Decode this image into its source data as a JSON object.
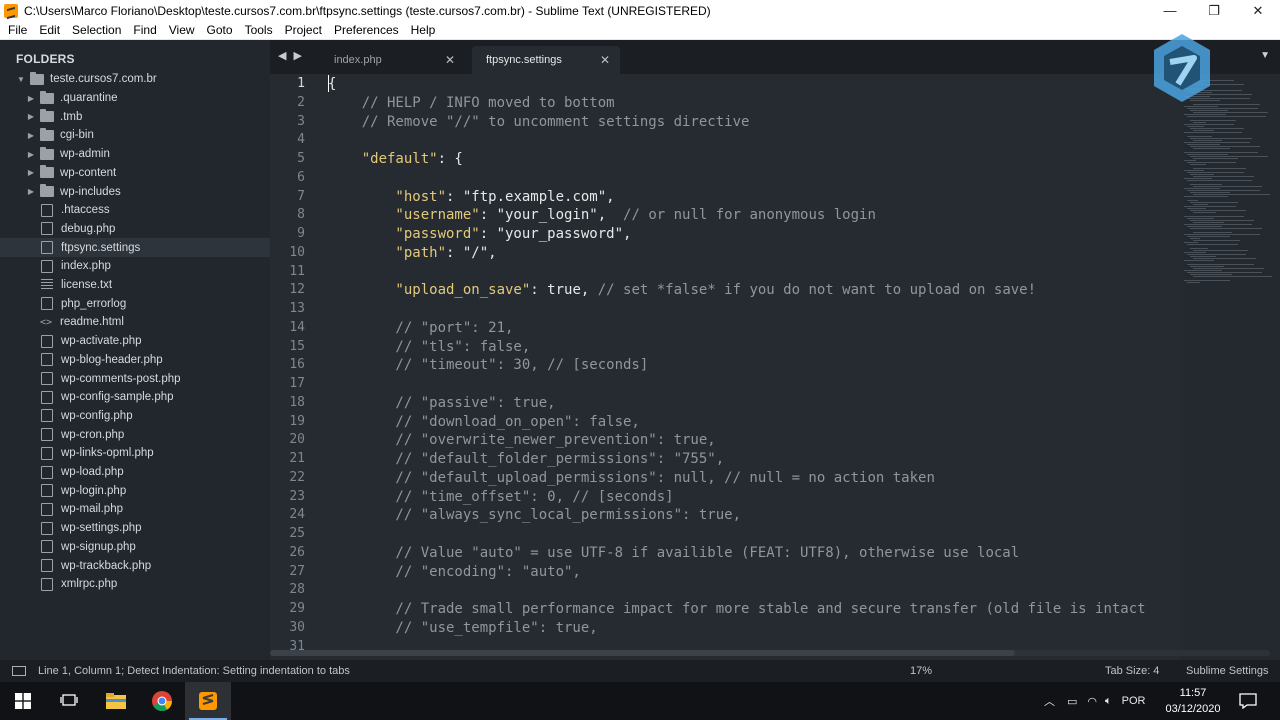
{
  "window": {
    "title": "C:\\Users\\Marco Floriano\\Desktop\\teste.cursos7.com.br\\ftpsync.settings (teste.cursos7.com.br) - Sublime Text (UNREGISTERED)",
    "minimize": "—",
    "maximize": "❐",
    "close": "✕"
  },
  "menu": [
    "File",
    "Edit",
    "Selection",
    "Find",
    "View",
    "Goto",
    "Tools",
    "Project",
    "Preferences",
    "Help"
  ],
  "sidebar": {
    "header": "FOLDERS",
    "root": "teste.cursos7.com.br",
    "folders": [
      ".quarantine",
      ".tmb",
      "cgi-bin",
      "wp-admin",
      "wp-content",
      "wp-includes"
    ],
    "files": [
      {
        "name": ".htaccess",
        "icon": "file-icon"
      },
      {
        "name": "debug.php",
        "icon": "file-icon"
      },
      {
        "name": "ftpsync.settings",
        "icon": "file-icon",
        "selected": true
      },
      {
        "name": "index.php",
        "icon": "file-icon"
      },
      {
        "name": "license.txt",
        "icon": "text-lines-icon"
      },
      {
        "name": "php_errorlog",
        "icon": "file-icon"
      },
      {
        "name": "readme.html",
        "icon": "code-icon"
      },
      {
        "name": "wp-activate.php",
        "icon": "file-icon"
      },
      {
        "name": "wp-blog-header.php",
        "icon": "file-icon"
      },
      {
        "name": "wp-comments-post.php",
        "icon": "file-icon"
      },
      {
        "name": "wp-config-sample.php",
        "icon": "file-icon"
      },
      {
        "name": "wp-config.php",
        "icon": "file-icon"
      },
      {
        "name": "wp-cron.php",
        "icon": "file-icon"
      },
      {
        "name": "wp-links-opml.php",
        "icon": "file-icon"
      },
      {
        "name": "wp-load.php",
        "icon": "file-icon"
      },
      {
        "name": "wp-login.php",
        "icon": "file-icon"
      },
      {
        "name": "wp-mail.php",
        "icon": "file-icon"
      },
      {
        "name": "wp-settings.php",
        "icon": "file-icon"
      },
      {
        "name": "wp-signup.php",
        "icon": "file-icon"
      },
      {
        "name": "wp-trackback.php",
        "icon": "file-icon"
      },
      {
        "name": "xmlrpc.php",
        "icon": "file-icon"
      }
    ]
  },
  "tabs": [
    {
      "label": "index.php",
      "active": false
    },
    {
      "label": "ftpsync.settings",
      "active": true
    }
  ],
  "tab_nav": "◀ ▶",
  "tab_menu": "▼",
  "editor": {
    "lines": [
      {
        "n": "1",
        "segs": [
          [
            "c-val",
            "{"
          ]
        ]
      },
      {
        "n": "2",
        "segs": [
          [
            "c-cmt",
            "    // HELP / INFO moved to bottom"
          ]
        ]
      },
      {
        "n": "3",
        "segs": [
          [
            "c-cmt",
            "    // Remove \"//\" to uncomment settings directive"
          ]
        ]
      },
      {
        "n": "4",
        "segs": []
      },
      {
        "n": "5",
        "segs": [
          [
            "c-key",
            "    \"default\""
          ],
          [
            "c-val",
            ": {"
          ]
        ]
      },
      {
        "n": "6",
        "segs": []
      },
      {
        "n": "7",
        "segs": [
          [
            "c-key",
            "        \"host\""
          ],
          [
            "c-val",
            ": "
          ],
          [
            "c-str",
            "\"ftp.example.com\""
          ],
          [
            "c-val",
            ","
          ]
        ]
      },
      {
        "n": "8",
        "segs": [
          [
            "c-key",
            "        \"username\""
          ],
          [
            "c-val",
            ": "
          ],
          [
            "c-str",
            "\"your_login\""
          ],
          [
            "c-val",
            ",  "
          ],
          [
            "c-cmt",
            "// or null for anonymous login"
          ]
        ]
      },
      {
        "n": "9",
        "segs": [
          [
            "c-key",
            "        \"password\""
          ],
          [
            "c-val",
            ": "
          ],
          [
            "c-str",
            "\"your_password\""
          ],
          [
            "c-val",
            ","
          ]
        ]
      },
      {
        "n": "10",
        "segs": [
          [
            "c-key",
            "        \"path\""
          ],
          [
            "c-val",
            ": "
          ],
          [
            "c-str",
            "\"/\""
          ],
          [
            "c-val",
            ","
          ]
        ]
      },
      {
        "n": "11",
        "segs": []
      },
      {
        "n": "12",
        "segs": [
          [
            "c-key",
            "        \"upload_on_save\""
          ],
          [
            "c-val",
            ": true, "
          ],
          [
            "c-cmt",
            "// set *false* if you do not want to upload on save!"
          ]
        ]
      },
      {
        "n": "13",
        "segs": []
      },
      {
        "n": "14",
        "segs": [
          [
            "c-cmt",
            "        // \"port\": 21,"
          ]
        ]
      },
      {
        "n": "15",
        "segs": [
          [
            "c-cmt",
            "        // \"tls\": false,"
          ]
        ]
      },
      {
        "n": "16",
        "segs": [
          [
            "c-cmt",
            "        // \"timeout\": 30, // [seconds]"
          ]
        ]
      },
      {
        "n": "17",
        "segs": []
      },
      {
        "n": "18",
        "segs": [
          [
            "c-cmt",
            "        // \"passive\": true,"
          ]
        ]
      },
      {
        "n": "19",
        "segs": [
          [
            "c-cmt",
            "        // \"download_on_open\": false,"
          ]
        ]
      },
      {
        "n": "20",
        "segs": [
          [
            "c-cmt",
            "        // \"overwrite_newer_prevention\": true,"
          ]
        ]
      },
      {
        "n": "21",
        "segs": [
          [
            "c-cmt",
            "        // \"default_folder_permissions\": \"755\","
          ]
        ]
      },
      {
        "n": "22",
        "segs": [
          [
            "c-cmt",
            "        // \"default_upload_permissions\": null, // null = no action taken"
          ]
        ]
      },
      {
        "n": "23",
        "segs": [
          [
            "c-cmt",
            "        // \"time_offset\": 0, // [seconds]"
          ]
        ]
      },
      {
        "n": "24",
        "segs": [
          [
            "c-cmt",
            "        // \"always_sync_local_permissions\": true,"
          ]
        ]
      },
      {
        "n": "25",
        "segs": []
      },
      {
        "n": "26",
        "segs": [
          [
            "c-cmt",
            "        // Value \"auto\" = use UTF-8 if availible (FEAT: UTF8), otherwise use local"
          ]
        ]
      },
      {
        "n": "27",
        "segs": [
          [
            "c-cmt",
            "        // \"encoding\": \"auto\","
          ]
        ]
      },
      {
        "n": "28",
        "segs": []
      },
      {
        "n": "29",
        "segs": [
          [
            "c-cmt",
            "        // Trade small performance impact for more stable and secure transfer (old file is intact"
          ]
        ]
      },
      {
        "n": "30",
        "segs": [
          [
            "c-cmt",
            "        // \"use_tempfile\": true,"
          ]
        ]
      },
      {
        "n": "31",
        "segs": []
      }
    ]
  },
  "status": {
    "message": "Line 1, Column 1; Detect Indentation: Setting indentation to tabs",
    "zoom": "17%",
    "tab_size": "Tab Size: 4",
    "syntax": "Sublime Settings"
  },
  "taskbar": {
    "language": "POR",
    "time": "11:57",
    "date": "03/12/2020"
  },
  "colors": {
    "accent": "#77aee8",
    "sublime_orange": "#ff9800",
    "logo_blue": "#4aa3df"
  }
}
